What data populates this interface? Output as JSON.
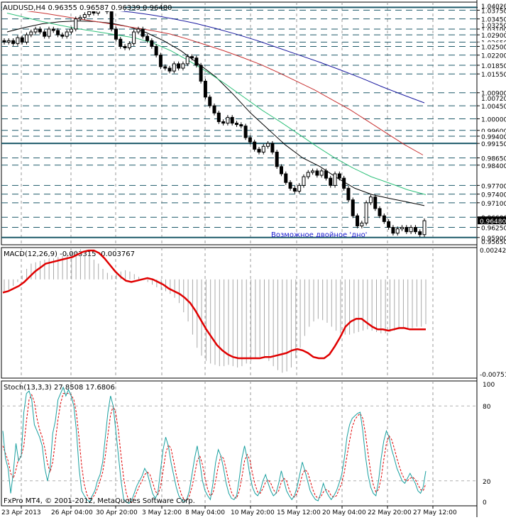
{
  "chart_data": [
    {
      "type": "candlestick",
      "title": "AUDUSD,H4  0.96355 0.96587 0.96339 0.96480",
      "symbol": "AUDUSD",
      "timeframe": "H4",
      "ohlc_last": {
        "open": 0.96355,
        "high": 0.96587,
        "low": 0.96339,
        "close": 0.9648
      },
      "ylim": [
        0.9565,
        1.0403
      ],
      "y_axis_extremes": [
        "1.04020",
        "0.95650"
      ],
      "levels": [
        1.0385,
        1.0375,
        1.0345,
        1.031,
        1.029,
        1.0265,
        1.025,
        1.022,
        1.0185,
        1.0155,
        1.009,
        1.0045,
        1.0,
        0.996,
        0.994,
        0.9915,
        0.9865,
        0.984,
        0.977,
        0.974,
        0.971,
        0.966,
        0.9625,
        0.959
      ],
      "level_labels": [
        "1.03850",
        "1.03750",
        "1.03450",
        "1.03100",
        "1.02900",
        "1.02650",
        "1.02500",
        "1.02200",
        "1.01850",
        "1.01550",
        "1.00900",
        "1.00450",
        "1.00000",
        "0.99600",
        "0.99400",
        "0.99150",
        "0.98650",
        "0.98400",
        "0.97700",
        "0.97400",
        "0.97100",
        "0.96600",
        "0.96250",
        "0.95900"
      ],
      "grid_ticks": [
        "1.03250",
        "1.00720",
        "0.96480"
      ],
      "annotation": "Возможное двойное 'дно'",
      "closes": [
        1.0265,
        1.027,
        1.026,
        1.028,
        1.0265,
        1.029,
        1.03,
        1.031,
        1.03,
        1.0285,
        1.031,
        1.0305,
        1.029,
        1.0285,
        1.03,
        1.031,
        1.0345,
        1.035,
        1.036,
        1.037,
        1.0365,
        1.038,
        1.039,
        1.037,
        1.031,
        1.0275,
        1.025,
        1.0245,
        1.026,
        1.03,
        1.031,
        1.0285,
        1.027,
        1.025,
        1.022,
        1.018,
        1.0175,
        1.0165,
        1.019,
        1.0175,
        1.019,
        1.0215,
        1.021,
        1.0185,
        1.013,
        1.0075,
        1.0045,
        1.002,
        0.999,
        0.9985,
        1.0005,
        0.9985,
        0.998,
        0.9975,
        0.9935,
        0.992,
        0.9895,
        0.9885,
        0.9905,
        0.9915,
        0.9885,
        0.9835,
        0.981,
        0.978,
        0.976,
        0.975,
        0.977,
        0.98,
        0.9815,
        0.982,
        0.9805,
        0.982,
        0.9795,
        0.977,
        0.981,
        0.9795,
        0.976,
        0.972,
        0.9665,
        0.963,
        0.964,
        0.971,
        0.973,
        0.969,
        0.9665,
        0.9645,
        0.9625,
        0.9605,
        0.962,
        0.9625,
        0.961,
        0.9625,
        0.961,
        0.96,
        0.9648
      ],
      "moving_averages": [
        {
          "color": "#000000",
          "values": [
            1.03,
            1.0315,
            1.0328,
            1.0335,
            1.0338,
            1.0336,
            1.033,
            1.0318,
            1.0298,
            1.027,
            1.0235,
            1.019,
            1.0145,
            1.0085,
            1.002,
            0.9965,
            0.991,
            0.9865,
            0.9835,
            0.9795,
            0.976,
            0.9738,
            0.9725,
            0.9713,
            0.97
          ]
        },
        {
          "color": "#2ec07a",
          "values": [
            1.0365,
            1.035,
            1.0335,
            1.0322,
            1.031,
            1.03,
            1.029,
            1.028,
            1.0262,
            1.0235,
            1.02,
            1.0162,
            1.012,
            1.0075,
            1.003,
            0.999,
            0.9948,
            0.9905,
            0.9865,
            0.983,
            0.98,
            0.9778,
            0.9755,
            0.9738
          ]
        },
        {
          "color": "#c83232",
          "values": [
            1.038,
            1.0373,
            1.0365,
            1.0355,
            1.0345,
            1.0335,
            1.0325,
            1.0315,
            1.0305,
            1.0293,
            1.0275,
            1.0255,
            1.0235,
            1.0212,
            1.0188,
            1.016,
            1.013,
            1.01,
            1.0065,
            1.003,
            0.999,
            0.995,
            0.991,
            0.9875
          ]
        },
        {
          "color": "#1a1aa0",
          "values": [
            1.04,
            1.0395,
            1.039,
            1.0385,
            1.038,
            1.0375,
            1.0368,
            1.0358,
            1.0345,
            1.033,
            1.0312,
            1.0292,
            1.027,
            1.0245,
            1.022,
            1.0195,
            1.0168,
            1.014,
            1.011,
            1.0082,
            1.0055
          ]
        }
      ]
    },
    {
      "type": "histogram+line",
      "title": "MACD(12,26,9) -0.003315 -0.003767",
      "ylim": [
        -0.00751,
        0.00242
      ],
      "tick_labels": [
        "0.002422",
        "-0.00751"
      ],
      "histogram": [
        -0.001,
        -0.0008,
        -0.0005,
        -0.0002,
        0.0003,
        0.0008,
        0.0012,
        0.0013,
        0.0014,
        0.0015,
        0.0016,
        0.0016,
        0.0017,
        0.0018,
        0.002,
        0.0021,
        0.0022,
        0.0023,
        0.0021,
        0.0018,
        0.0015,
        0.0012,
        0.0008,
        0.0005,
        0.0003,
        0.0004,
        0.0006,
        0.0007,
        0.0006,
        0.0004,
        0.0002,
        0.0,
        -0.0002,
        -0.0004,
        -0.0006,
        -0.0008,
        -0.0009,
        -0.0011,
        -0.0014,
        -0.0018,
        -0.0025,
        -0.0032,
        -0.0042,
        -0.0052,
        -0.0058,
        -0.0062,
        -0.0064,
        -0.0065,
        -0.0066,
        -0.0066,
        -0.0065,
        -0.0066,
        -0.0067,
        -0.0066,
        -0.0064,
        -0.0062,
        -0.006,
        -0.0059,
        -0.006,
        -0.0062,
        -0.0066,
        -0.0069,
        -0.0071,
        -0.007,
        -0.0067,
        -0.006,
        -0.0052,
        -0.0043,
        -0.0036,
        -0.0032,
        -0.003,
        -0.0031,
        -0.0033,
        -0.0036,
        -0.0039,
        -0.0041,
        -0.0042,
        -0.0042,
        -0.0041,
        -0.004,
        -0.0039,
        -0.0038,
        -0.0039,
        -0.004,
        -0.0041,
        -0.0041,
        -0.004,
        -0.0039,
        -0.0038,
        -0.0037,
        -0.0037,
        -0.0037,
        -0.0036,
        -0.0036,
        -0.0034
      ],
      "signal": [
        -0.001,
        -0.0009,
        -0.0007,
        -0.0005,
        -0.0002,
        0.0002,
        0.0006,
        0.0009,
        0.0012,
        0.0013,
        0.0014,
        0.0015,
        0.0016,
        0.0017,
        0.0019,
        0.0021,
        0.0022,
        0.0022,
        0.002,
        0.0016,
        0.0011,
        0.0006,
        0.0002,
        -0.0001,
        -0.0002,
        -0.0001,
        0.0,
        0.0001,
        0.0,
        -0.0002,
        -0.0004,
        -0.0007,
        -0.0009,
        -0.0011,
        -0.0014,
        -0.0018,
        -0.0024,
        -0.0031,
        -0.0038,
        -0.0044,
        -0.005,
        -0.0054,
        -0.0057,
        -0.0059,
        -0.006,
        -0.006,
        -0.006,
        -0.006,
        -0.006,
        -0.0059,
        -0.0059,
        -0.0058,
        -0.0057,
        -0.0056,
        -0.0054,
        -0.0053,
        -0.0054,
        -0.0056,
        -0.0059,
        -0.006,
        -0.006,
        -0.0057,
        -0.0051,
        -0.0044,
        -0.0036,
        -0.0032,
        -0.003,
        -0.003,
        -0.0033,
        -0.0036,
        -0.0038,
        -0.0038,
        -0.0039,
        -0.0038,
        -0.0037,
        -0.0037,
        -0.0038,
        -0.0038,
        -0.0038,
        -0.0038
      ]
    },
    {
      "type": "line",
      "title": "Stoch(13,3,3) 27.8508 17.6806",
      "ylim": [
        0,
        100
      ],
      "tick_labels": [
        "100",
        "80",
        "20",
        "0"
      ],
      "levels": [
        80,
        20
      ],
      "main": [
        60,
        38,
        30,
        10,
        27,
        50,
        36,
        40,
        75,
        90,
        92,
        85,
        65,
        60,
        55,
        48,
        30,
        20,
        30,
        58,
        68,
        85,
        90,
        95,
        88,
        93,
        88,
        80,
        60,
        30,
        12,
        8,
        5,
        3,
        8,
        12,
        20,
        25,
        35,
        55,
        75,
        88,
        80,
        60,
        40,
        20,
        5,
        3,
        2,
        4,
        10,
        16,
        20,
        24,
        30,
        26,
        18,
        10,
        6,
        10,
        28,
        45,
        55,
        48,
        35,
        25,
        15,
        8,
        5,
        3,
        5,
        12,
        25,
        38,
        48,
        35,
        20,
        12,
        8,
        5,
        18,
        35,
        45,
        40,
        30,
        18,
        10,
        6,
        5,
        8,
        22,
        38,
        48,
        38,
        25,
        15,
        10,
        8,
        12,
        20,
        25,
        18,
        12,
        8,
        10,
        18,
        28,
        20,
        12,
        8,
        5,
        8,
        15,
        25,
        35,
        28,
        20,
        12,
        8,
        5,
        4,
        10,
        18,
        12,
        8,
        5,
        8,
        12,
        18,
        25,
        38,
        55,
        65,
        70,
        72,
        74,
        75,
        60,
        40,
        25,
        15,
        10,
        8,
        20,
        38,
        52,
        60,
        55,
        45,
        38,
        30,
        25,
        20,
        18,
        22,
        26,
        22,
        18,
        12,
        10,
        15,
        27.85
      ],
      "signal": [
        48,
        42,
        36,
        26,
        22,
        29,
        38,
        40,
        48,
        68,
        85,
        89,
        83,
        70,
        61,
        55,
        46,
        34,
        27,
        35,
        52,
        69,
        82,
        90,
        90,
        90,
        89,
        85,
        74,
        54,
        32,
        17,
        9,
        5,
        6,
        9,
        14,
        20,
        27,
        40,
        57,
        73,
        80,
        74,
        60,
        40,
        22,
        10,
        4,
        3,
        6,
        11,
        16,
        20,
        25,
        27,
        25,
        19,
        12,
        9,
        15,
        28,
        42,
        49,
        46,
        36,
        25,
        16,
        9,
        5,
        4,
        8,
        15,
        25,
        36,
        40,
        33,
        22,
        13,
        8,
        10,
        20,
        32,
        40,
        38,
        29,
        19,
        11,
        7,
        6,
        12,
        23,
        36,
        41,
        37,
        26,
        17,
        11,
        10,
        14,
        19,
        21,
        18,
        13,
        10,
        12,
        19,
        22,
        20,
        13,
        8,
        7,
        10,
        16,
        25,
        29,
        27,
        20,
        13,
        8,
        6,
        7,
        11,
        13,
        12,
        8,
        7,
        8,
        13,
        18,
        27,
        40,
        52,
        63,
        69,
        72,
        74,
        70,
        58,
        42,
        27,
        17,
        11,
        13,
        22,
        37,
        50,
        56,
        53,
        46,
        38,
        31,
        25,
        21,
        20,
        22,
        23,
        21,
        17,
        13,
        12,
        17.68
      ],
      "x_tick_labels": [
        "23 Apr 2013",
        "26 Apr 04:00",
        "30 Apr 20:00",
        "3 May 12:00",
        "8 May 04:00",
        "10 May 20:00",
        "15 May 12:00",
        "20 May 04:00",
        "22 May 20:00",
        "27 May 12:00"
      ],
      "watermark": "FxPro MT4, © 2001-2012, MetaQuotes Software Corp."
    }
  ]
}
